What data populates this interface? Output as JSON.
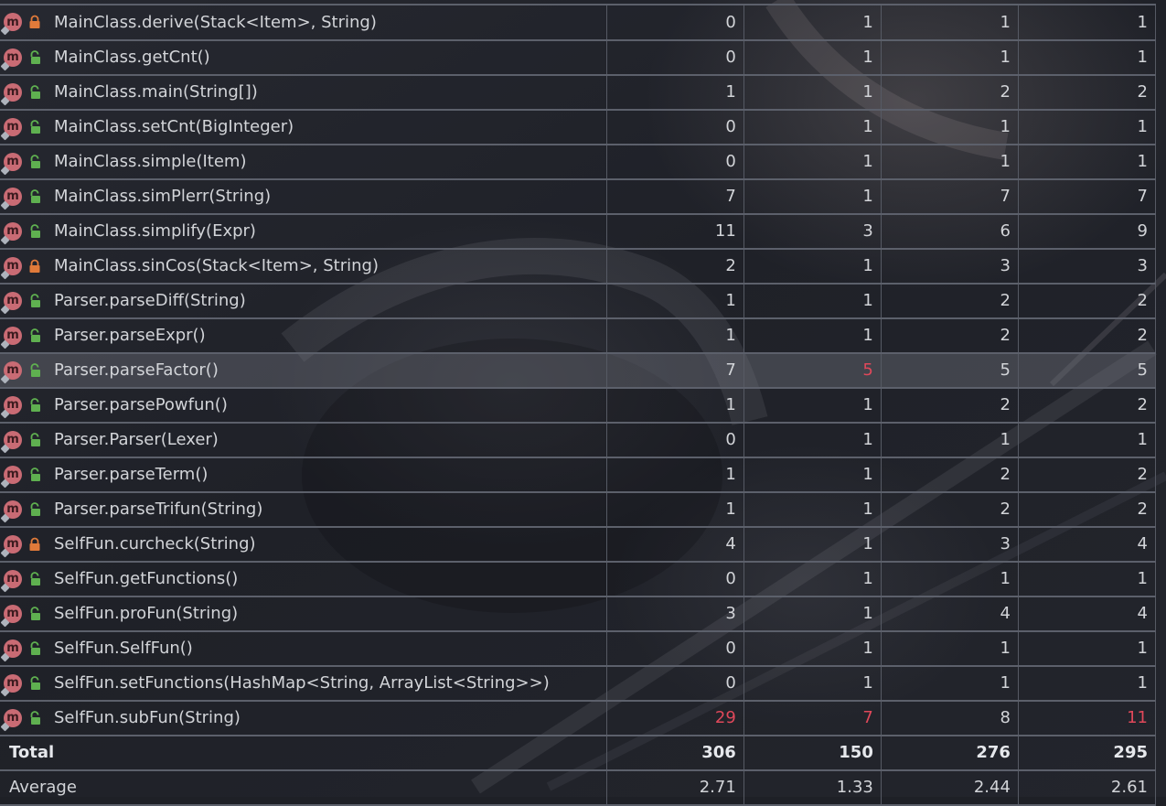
{
  "colors": {
    "accent_red": "#e0485a",
    "public_lock": "#5fb050",
    "private_lock": "#e07a3a",
    "method_icon": "#c96b74"
  },
  "rows": [
    {
      "name": "MainClass.derive(Stack<Item>, String)",
      "access": "private",
      "v1": "0",
      "v2": "1",
      "v3": "1",
      "v4": "1"
    },
    {
      "name": "MainClass.getCnt()",
      "access": "public",
      "v1": "0",
      "v2": "1",
      "v3": "1",
      "v4": "1"
    },
    {
      "name": "MainClass.main(String[])",
      "access": "public",
      "v1": "1",
      "v2": "1",
      "v3": "2",
      "v4": "2"
    },
    {
      "name": "MainClass.setCnt(BigInteger)",
      "access": "public",
      "v1": "0",
      "v2": "1",
      "v3": "1",
      "v4": "1"
    },
    {
      "name": "MainClass.simple(Item)",
      "access": "public",
      "v1": "0",
      "v2": "1",
      "v3": "1",
      "v4": "1"
    },
    {
      "name": "MainClass.simPlerr(String)",
      "access": "public",
      "v1": "7",
      "v2": "1",
      "v3": "7",
      "v4": "7"
    },
    {
      "name": "MainClass.simplify(Expr)",
      "access": "public",
      "v1": "11",
      "v2": "3",
      "v3": "6",
      "v4": "9"
    },
    {
      "name": "MainClass.sinCos(Stack<Item>, String)",
      "access": "private",
      "v1": "2",
      "v2": "1",
      "v3": "3",
      "v4": "3"
    },
    {
      "name": "Parser.parseDiff(String)",
      "access": "public",
      "v1": "1",
      "v2": "1",
      "v3": "2",
      "v4": "2"
    },
    {
      "name": "Parser.parseExpr()",
      "access": "public",
      "v1": "1",
      "v2": "1",
      "v3": "2",
      "v4": "2"
    },
    {
      "name": "Parser.parseFactor()",
      "access": "public",
      "v1": "7",
      "v2": "5",
      "v3": "5",
      "v4": "5",
      "selected": true,
      "hot": [
        2
      ]
    },
    {
      "name": "Parser.parsePowfun()",
      "access": "public",
      "v1": "1",
      "v2": "1",
      "v3": "2",
      "v4": "2"
    },
    {
      "name": "Parser.Parser(Lexer)",
      "access": "public",
      "v1": "0",
      "v2": "1",
      "v3": "1",
      "v4": "1"
    },
    {
      "name": "Parser.parseTerm()",
      "access": "public",
      "v1": "1",
      "v2": "1",
      "v3": "2",
      "v4": "2"
    },
    {
      "name": "Parser.parseTrifun(String)",
      "access": "public",
      "v1": "1",
      "v2": "1",
      "v3": "2",
      "v4": "2"
    },
    {
      "name": "SelfFun.curcheck(String)",
      "access": "private",
      "v1": "4",
      "v2": "1",
      "v3": "3",
      "v4": "4"
    },
    {
      "name": "SelfFun.getFunctions()",
      "access": "public",
      "v1": "0",
      "v2": "1",
      "v3": "1",
      "v4": "1"
    },
    {
      "name": "SelfFun.proFun(String)",
      "access": "public",
      "v1": "3",
      "v2": "1",
      "v3": "4",
      "v4": "4"
    },
    {
      "name": "SelfFun.SelfFun()",
      "access": "public",
      "v1": "0",
      "v2": "1",
      "v3": "1",
      "v4": "1"
    },
    {
      "name": "SelfFun.setFunctions(HashMap<String, ArrayList<String>>)",
      "access": "public",
      "v1": "0",
      "v2": "1",
      "v3": "1",
      "v4": "1"
    },
    {
      "name": "SelfFun.subFun(String)",
      "access": "public",
      "v1": "29",
      "v2": "7",
      "v3": "8",
      "v4": "11",
      "hot": [
        1,
        2,
        4
      ]
    }
  ],
  "total": {
    "label": "Total",
    "v1": "306",
    "v2": "150",
    "v3": "276",
    "v4": "295"
  },
  "average": {
    "label": "Average",
    "v1": "2.71",
    "v2": "1.33",
    "v3": "2.44",
    "v4": "2.61"
  }
}
